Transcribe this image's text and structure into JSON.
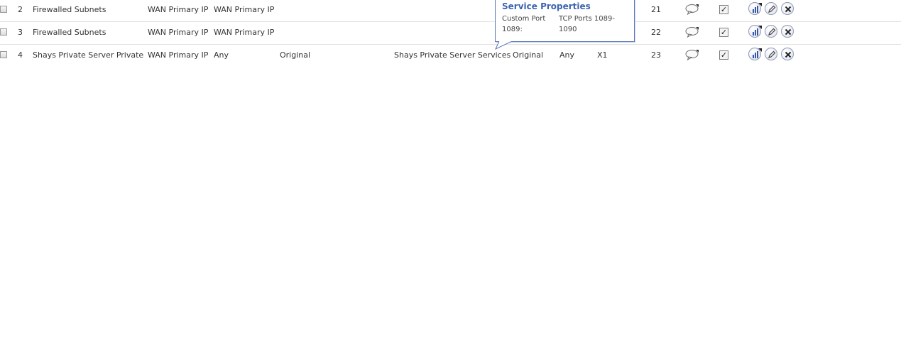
{
  "rules": [
    {
      "num": "2",
      "original_source": "Firewalled Subnets",
      "translated_source": "WAN Primary IP",
      "original_destination": "WAN Primary IP",
      "translated_destination": "",
      "original_service": "",
      "translated_service": "",
      "inbound": "",
      "outbound": "",
      "priority": "21",
      "enabled": true
    },
    {
      "num": "3",
      "original_source": "Firewalled Subnets",
      "translated_source": "WAN Primary IP",
      "original_destination": "WAN Primary IP",
      "translated_destination": "",
      "original_service": "",
      "translated_service": "",
      "inbound": "",
      "outbound": "",
      "priority": "22",
      "enabled": true
    },
    {
      "num": "4",
      "original_source": "Shays Private Server Private",
      "translated_source": "WAN Primary IP",
      "original_destination": "Any",
      "translated_destination": "Original",
      "original_service": "Shays Private Server Services",
      "translated_service": "Original",
      "inbound": "Any",
      "outbound": "X1",
      "priority": "23",
      "enabled": true
    }
  ],
  "tooltip": {
    "title": "Service Properties",
    "key": "Custom Port 1089:",
    "value": "TCP Ports 1089-1090"
  },
  "icons": {
    "comment": "comment-bubble-icon",
    "stats": "statistics-icon",
    "edit": "pencil-icon",
    "delete": "close-icon"
  },
  "colors": {
    "tooltip_title": "#3a64b0",
    "tooltip_border": "#5b78b8",
    "row_divider": "#e1e1e1"
  }
}
